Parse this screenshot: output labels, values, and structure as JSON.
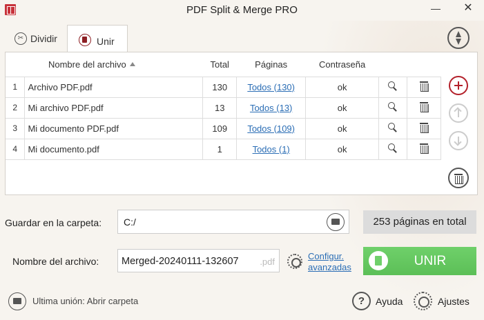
{
  "window": {
    "title": "PDF Split & Merge PRO",
    "minimize": "—",
    "close": "✕"
  },
  "tabs": [
    {
      "label": "Dividir"
    },
    {
      "label": "Unir"
    }
  ],
  "table": {
    "headers": {
      "name": "Nombre del archivo",
      "total": "Total",
      "pages": "Páginas",
      "password": "Contraseña"
    },
    "rows": [
      {
        "num": "1",
        "name": "Archivo PDF.pdf",
        "total": "130",
        "pages": "Todos (130)",
        "password": "ok"
      },
      {
        "num": "2",
        "name": "Mi archivo PDF.pdf",
        "total": "13",
        "pages": "Todos (13)",
        "password": "ok"
      },
      {
        "num": "3",
        "name": "Mi documento PDF.pdf",
        "total": "109",
        "pages": "Todos (109)",
        "password": "ok"
      },
      {
        "num": "4",
        "name": "Mi documento.pdf",
        "total": "1",
        "pages": "Todos (1)",
        "password": "ok"
      }
    ]
  },
  "form": {
    "folder_label": "Guardar en la carpeta:",
    "folder_value": "C:/",
    "filename_label": "Nombre del archivo:",
    "filename_value": "Merged-20240111-132607",
    "filename_ext": ".pdf",
    "advanced_line1": "Configur.",
    "advanced_line2": "avanzadas",
    "total_pages": "253 páginas en total",
    "merge_button": "UNIR"
  },
  "footer": {
    "last_merge": "Ultima unión: Abrir carpeta",
    "help": "Ayuda",
    "settings": "Ajustes"
  },
  "colors": {
    "accent_red": "#b3202a",
    "merge_green": "#62c45d",
    "link_blue": "#2a6db5"
  }
}
